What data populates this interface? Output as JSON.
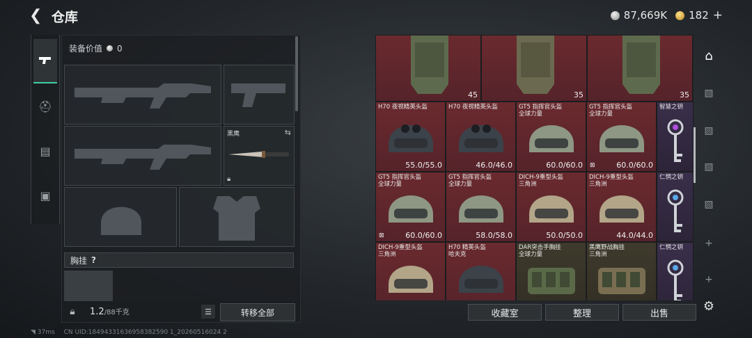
{
  "header": {
    "title": "仓库",
    "silver": "87,669K",
    "gold": "182",
    "plus": "+"
  },
  "loadout": {
    "equip_value_label": "装备价值",
    "equip_value": "0",
    "melee_name": "黑鹰",
    "vest_label": "胸挂",
    "vest_help": "?",
    "weight": "1.2",
    "weight_max": "/88千克",
    "transfer_all": "转移全部"
  },
  "grid": {
    "row0": [
      {
        "count": "45"
      },
      {
        "count": "35"
      },
      {
        "count": "35"
      }
    ],
    "items": [
      {
        "name": "H70 夜视精英头盔",
        "dur": "55.0/55.0",
        "color": "red",
        "flag": ""
      },
      {
        "name": "H70 夜视精英头盔",
        "dur": "46.0/46.0",
        "color": "red",
        "flag": ""
      },
      {
        "name": "GT5 指挥官头盔\n全球力量",
        "dur": "60.0/60.0",
        "color": "red",
        "flag": ""
      },
      {
        "name": "GT5 指挥官头盔\n全球力量",
        "dur": "60.0/60.0",
        "color": "red",
        "flag": "⊠"
      },
      {
        "name": "智慧之钥",
        "dur": "",
        "color": "purple",
        "flag": ""
      },
      {
        "name": "GT5 指挥官头盔\n全球力量",
        "dur": "60.0/60.0",
        "color": "red",
        "flag": "⊠"
      },
      {
        "name": "GT5 指挥官头盔\n全球力量",
        "dur": "58.0/58.0",
        "color": "red",
        "flag": ""
      },
      {
        "name": "DICH-9重型头盔\n三角洲",
        "dur": "50.0/50.0",
        "color": "red",
        "flag": ""
      },
      {
        "name": "DICH-9重型头盔\n三角洲",
        "dur": "44.0/44.0",
        "color": "red",
        "flag": ""
      },
      {
        "name": "仁惘之钥",
        "dur": "",
        "color": "purple",
        "flag": ""
      },
      {
        "name": "DICH-9重型头盔\n三角洲",
        "dur": "",
        "color": "red",
        "flag": ""
      },
      {
        "name": "H70 精英头盔\n哈夫克",
        "dur": "",
        "color": "red",
        "flag": ""
      },
      {
        "name": "DAR突击手胸挂\n全球力量",
        "dur": "",
        "color": "gold",
        "flag": ""
      },
      {
        "name": "黑鹰野战胸挂\n三角洲",
        "dur": "",
        "color": "gold",
        "flag": ""
      },
      {
        "name": "仁惘之钥",
        "dur": "",
        "color": "purple",
        "flag": ""
      }
    ]
  },
  "actions": {
    "collection": "收藏室",
    "sort": "整理",
    "sell": "出售"
  },
  "status": {
    "ping": "37ms",
    "uid": "CN UID:18494331636958382590 1_20260516024 2"
  }
}
